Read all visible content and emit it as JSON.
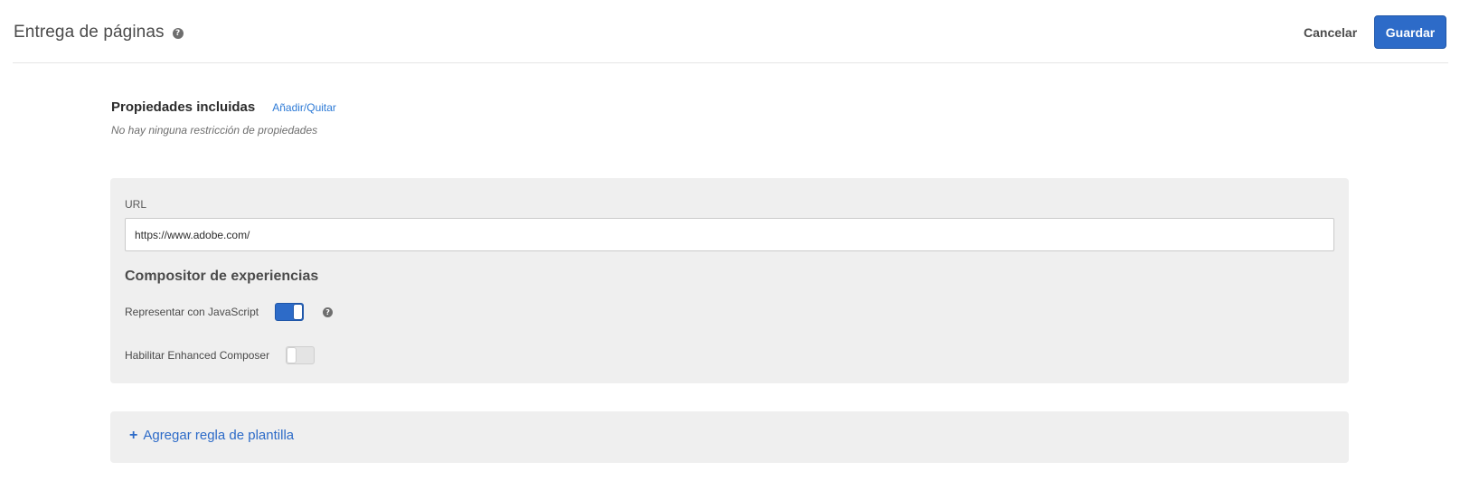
{
  "header": {
    "title": "Entrega de páginas",
    "help_icon": "question-circle-icon",
    "cancel_label": "Cancelar",
    "save_label": "Guardar",
    "accent_color": "#2d6bc8"
  },
  "properties": {
    "title": "Propiedades incluidas",
    "edit_link": "Añadir/Quitar",
    "note": "No hay ninguna restricción de propiedades"
  },
  "url_section": {
    "label": "URL",
    "value": "https://www.adobe.com/"
  },
  "composer": {
    "heading": "Compositor de experiencias",
    "render_js": {
      "label": "Representar con JavaScript",
      "enabled": true,
      "help_icon": "question-circle-icon"
    },
    "enhanced_composer": {
      "label": "Habilitar Enhanced Composer",
      "enabled": false
    }
  },
  "template_rule": {
    "icon": "plus-icon",
    "label": "Agregar regla de plantilla"
  }
}
